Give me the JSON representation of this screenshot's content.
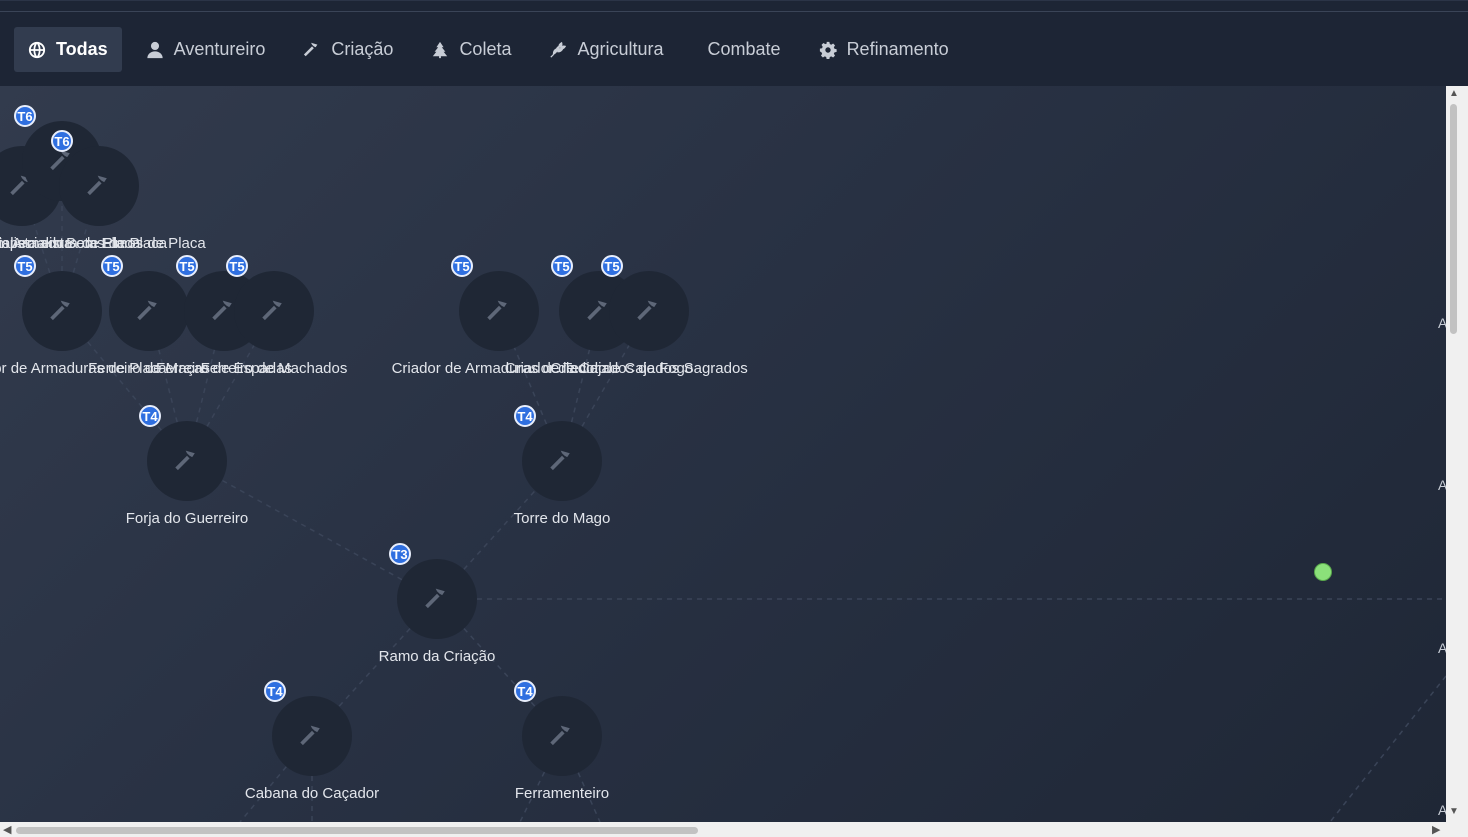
{
  "tabs": [
    {
      "label": "Todas",
      "icon": "globe-icon",
      "active": true
    },
    {
      "label": "Aventureiro",
      "icon": "user-icon"
    },
    {
      "label": "Criação",
      "icon": "hammer-icon"
    },
    {
      "label": "Coleta",
      "icon": "tree-icon"
    },
    {
      "label": "Agricultura",
      "icon": "wheat-icon"
    },
    {
      "label": "Combate",
      "icon": ""
    },
    {
      "label": "Refinamento",
      "icon": "gear-icon"
    }
  ],
  "nodes": [
    {
      "tier": "T6",
      "label": "Especialista em Armadura de Placa"
    },
    {
      "tier": "T6",
      "label": "Especialista em Botas de Placa"
    },
    {
      "tier": "T6",
      "label": "Especialista em Elmos de Placa"
    },
    {
      "tier": "T5",
      "label": "Criador de Armaduras de Placa"
    },
    {
      "tier": "T5",
      "label": "Ferreiro de Maças"
    },
    {
      "tier": "T5",
      "label": "Ferreiro de Espadas"
    },
    {
      "tier": "T5",
      "label": "Ferreiro de Machados"
    },
    {
      "tier": "T5",
      "label": "Criador de Armaduras de Tecido"
    },
    {
      "tier": "T5",
      "label": "Criador de Cajados de Fogo"
    },
    {
      "tier": "T5",
      "label": "Criador de Cajados Sagrados"
    },
    {
      "tier": "T4",
      "label": "Forja do Guerreiro"
    },
    {
      "tier": "T4",
      "label": "Torre do Mago"
    },
    {
      "tier": "T3",
      "label": "Ramo da Criação"
    },
    {
      "tier": "T4",
      "label": "Cabana do Caçador"
    },
    {
      "tier": "T4",
      "label": "Ferramenteiro"
    }
  ],
  "edge_letters": [
    "A",
    "A",
    "A",
    "A"
  ],
  "colors": {
    "badge": "#2f6fe0",
    "active_tab": "#323c4f",
    "status_dot": "#8be07a"
  }
}
